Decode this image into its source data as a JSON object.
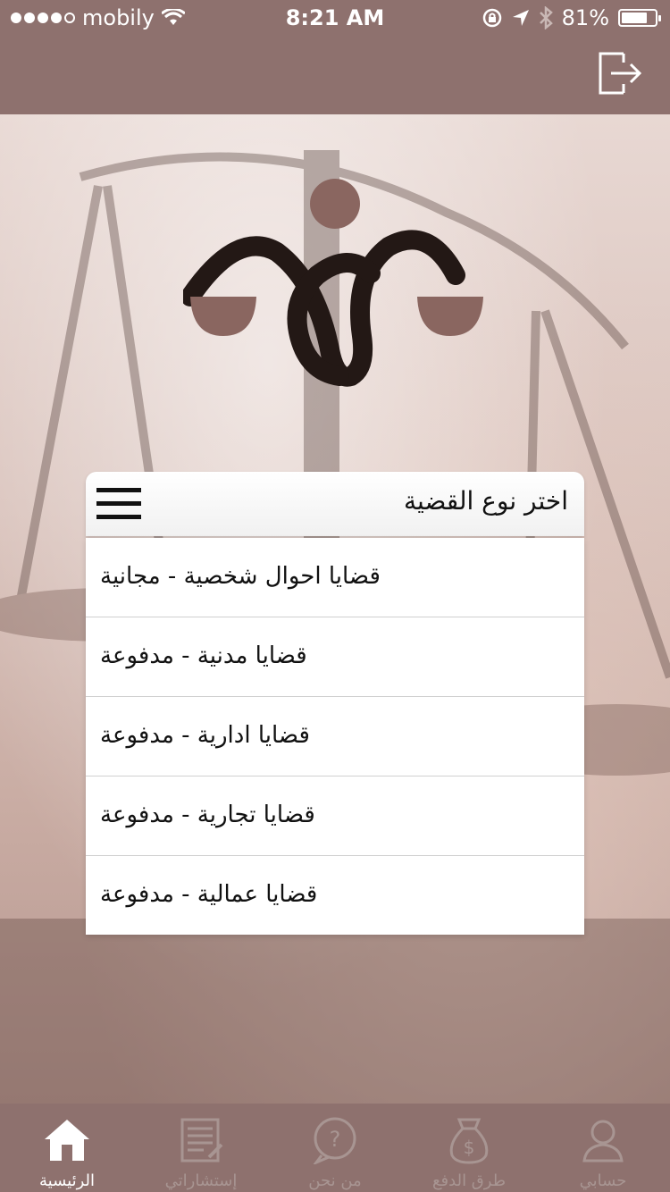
{
  "status_bar": {
    "carrier": "mobily",
    "time": "8:21 AM",
    "battery_percent_label": "81%",
    "battery_level": 0.81,
    "signal_bars_filled": 4,
    "signal_bars_total": 5
  },
  "header": {
    "logout_icon": "logout-icon"
  },
  "picker": {
    "title": "اختر نوع القضية",
    "menu_icon": "hamburger-icon",
    "items": [
      {
        "label": "قضايا احوال شخصية - مجانية"
      },
      {
        "label": "قضايا مدنية - مدفوعة"
      },
      {
        "label": "قضايا ادارية - مدفوعة"
      },
      {
        "label": "قضايا تجارية - مدفوعة"
      },
      {
        "label": "قضايا عمالية - مدفوعة"
      }
    ]
  },
  "tab_bar": {
    "tabs": [
      {
        "label": "الرئيسية",
        "icon": "home-icon",
        "active": true
      },
      {
        "label": "إستشاراتي",
        "icon": "document-icon",
        "active": false
      },
      {
        "label": "من نحن",
        "icon": "question-bubble-icon",
        "active": false
      },
      {
        "label": "طرق الدفع",
        "icon": "money-bag-icon",
        "active": false
      },
      {
        "label": "حسابي",
        "icon": "user-icon",
        "active": false
      }
    ]
  },
  "colors": {
    "brand": "#8e716e",
    "logo_dark": "#231815",
    "logo_accent": "#8a6660",
    "tab_inactive": "#a89592",
    "tab_active": "#ffffff"
  }
}
